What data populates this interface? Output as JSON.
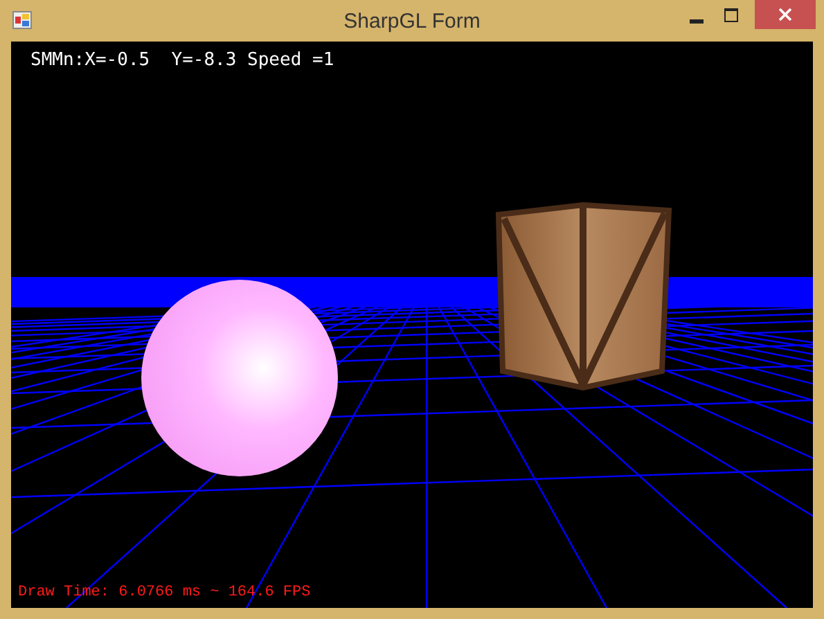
{
  "window": {
    "title": "SharpGL Form"
  },
  "viewport": {
    "overlay_text": "SMMn:X=-0.5  Y=-8.3 Speed =1",
    "status_text": "Draw Time: 6.0766 ms ~ 164.6 FPS"
  }
}
